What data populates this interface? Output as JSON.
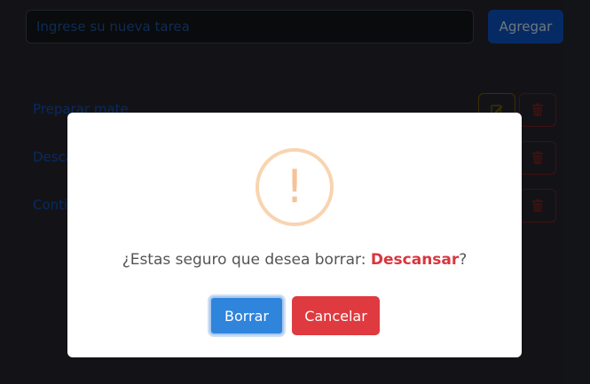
{
  "form": {
    "placeholder": "Ingrese su nueva tarea",
    "add_label": "Agregar"
  },
  "tasks": [
    {
      "label": "Preparar mate"
    },
    {
      "label": "Descansar"
    },
    {
      "label": "Continuar"
    }
  ],
  "icons": {
    "edit": "pencil-square-icon",
    "delete": "trash-icon",
    "warning": "exclamation-icon"
  },
  "modal": {
    "warning_symbol": "!",
    "message_prefix": "¿Estas seguro que desea borrar: ",
    "task_name": "Descansar",
    "message_suffix": "?",
    "confirm_label": "Borrar",
    "cancel_label": "Cancelar"
  },
  "colors": {
    "background": "#23242a",
    "link_blue": "#0d4bb4",
    "danger": "#d9363e",
    "warning": "#f5c39a",
    "confirm": "#2f84dc"
  }
}
